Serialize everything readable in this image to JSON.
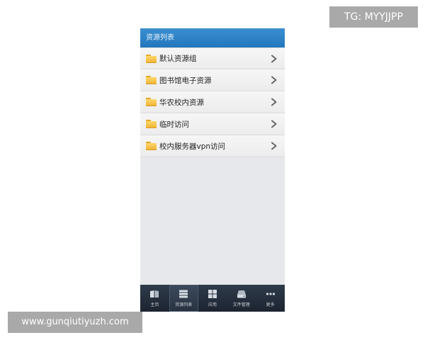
{
  "header": {
    "title": "资源列表"
  },
  "resources": [
    {
      "label": "默认资源组",
      "icon": "folder-icon"
    },
    {
      "label": "图书馆电子资源",
      "icon": "folder-icon"
    },
    {
      "label": "华农校内资源",
      "icon": "folder-icon"
    },
    {
      "label": "临时访问",
      "icon": "folder-icon"
    },
    {
      "label": "校内服务器vpn访问",
      "icon": "folder-icon"
    }
  ],
  "tabbar": {
    "items": [
      {
        "label": "主页",
        "icon": "home-book-icon",
        "active": false
      },
      {
        "label": "资源列表",
        "icon": "list-icon",
        "active": true
      },
      {
        "label": "应用",
        "icon": "grid-icon",
        "active": false
      },
      {
        "label": "文件管理",
        "icon": "drive-icon",
        "active": false
      },
      {
        "label": "更多",
        "icon": "more-dots-icon",
        "active": false
      }
    ]
  },
  "watermarks": {
    "tg": "TG: MYYJJPP",
    "url": "www.gunqiutiyuzh.com"
  },
  "colors": {
    "header": "#2277bd",
    "tabbar": "#1c2430",
    "folder": "#f0b233",
    "background": "#e6e8eb"
  }
}
